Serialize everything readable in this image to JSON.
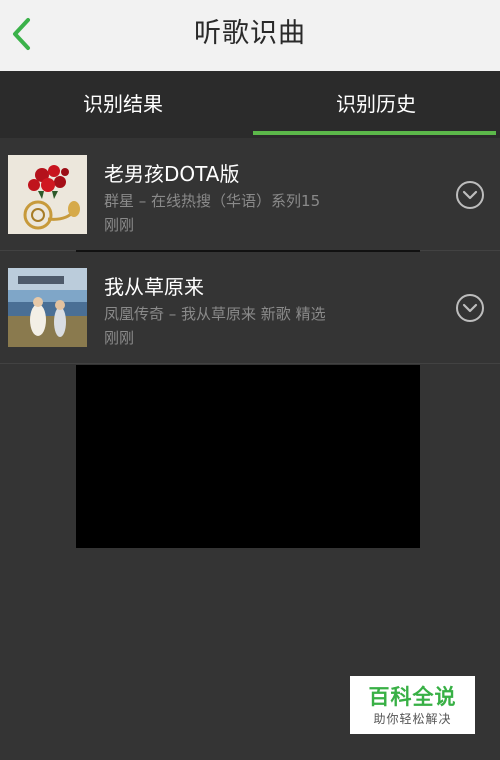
{
  "header": {
    "title": "听歌识曲"
  },
  "tabs": [
    {
      "label": "识别结果",
      "active": false
    },
    {
      "label": "识别历史",
      "active": true
    }
  ],
  "history": [
    {
      "title": "老男孩DOTA版",
      "subtitle": "群星 – 在线热搜（华语）系列15",
      "time": "刚刚",
      "cover_icon": "red-roses-french-horn-cover"
    },
    {
      "title": "我从草原来",
      "subtitle": "凤凰传奇 – 我从草原来 新歌 精选",
      "time": "刚刚",
      "cover_icon": "phoenix-legend-album-cover"
    }
  ],
  "watermark": {
    "main": "百科全说",
    "sub": "助你轻松解决"
  },
  "colors": {
    "accent": "#5cb84a",
    "background": "#343434",
    "title_bar": "#f2f2f2",
    "tab_bar": "#2b2b2b"
  }
}
